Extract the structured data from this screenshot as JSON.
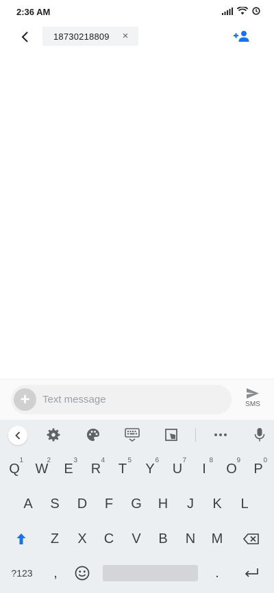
{
  "status_bar": {
    "time": "2:36 AM",
    "icons": [
      "signal-icon",
      "wifi-icon",
      "alarm-icon"
    ]
  },
  "header": {
    "back_icon": "back-arrow-icon",
    "recipient": "18730218809",
    "chip_close": "×",
    "add_contact_icon": "add-person-icon",
    "accent_color": "#1a73e8"
  },
  "composer": {
    "plus_icon": "plus-icon",
    "placeholder": "Text message",
    "value": "",
    "send_icon": "send-icon",
    "send_label": "SMS"
  },
  "keyboard": {
    "toolbar": [
      "back-icon",
      "settings-icon",
      "palette-icon",
      "keyboard-icon",
      "resize-icon",
      "more-icon",
      "mic-icon"
    ],
    "row1": [
      {
        "key": "Q",
        "hint": "1"
      },
      {
        "key": "W",
        "hint": "2"
      },
      {
        "key": "E",
        "hint": "3"
      },
      {
        "key": "R",
        "hint": "4"
      },
      {
        "key": "T",
        "hint": "5"
      },
      {
        "key": "Y",
        "hint": "6"
      },
      {
        "key": "U",
        "hint": "7"
      },
      {
        "key": "I",
        "hint": "8"
      },
      {
        "key": "O",
        "hint": "9"
      },
      {
        "key": "P",
        "hint": "0"
      }
    ],
    "row2": [
      "A",
      "S",
      "D",
      "F",
      "G",
      "H",
      "J",
      "K",
      "L"
    ],
    "row3": [
      "Z",
      "X",
      "C",
      "V",
      "B",
      "N",
      "M"
    ],
    "row4": {
      "symbols": "?123",
      "comma": ",",
      "period": "."
    },
    "shift_color": "#1a73e8"
  }
}
